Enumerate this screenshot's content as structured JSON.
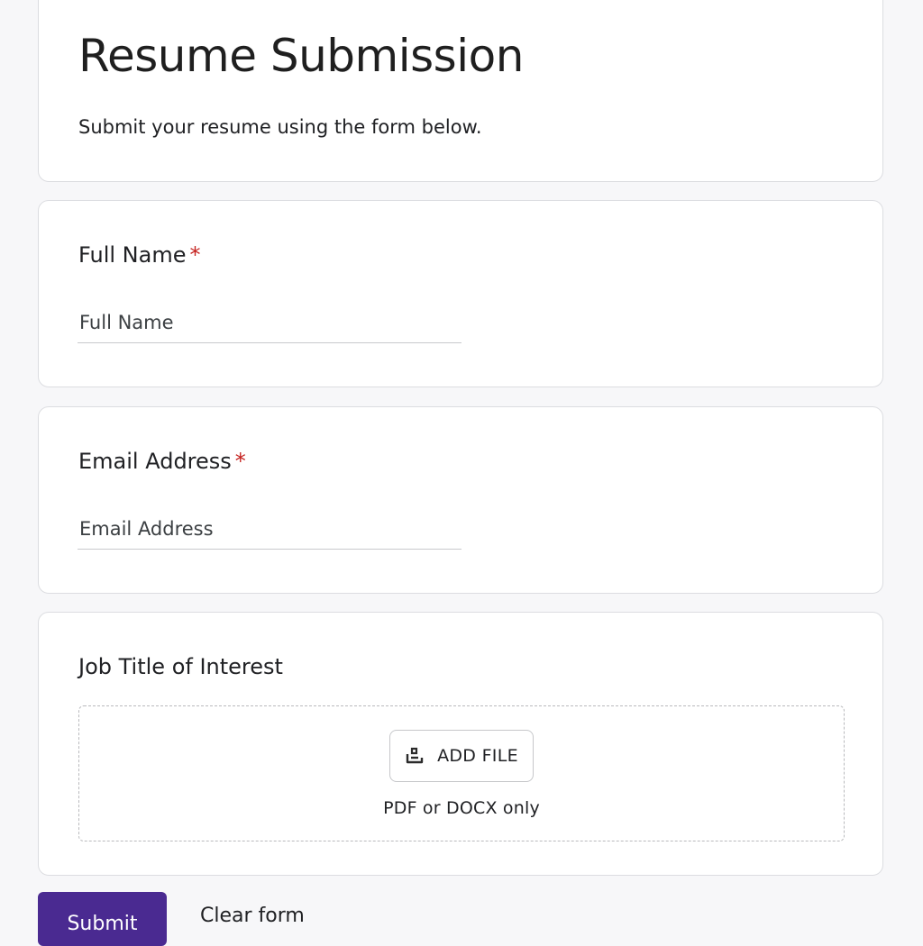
{
  "form": {
    "title": "Resume Submission",
    "description": "Submit your resume using the form below."
  },
  "questions": {
    "full_name": {
      "label": "Full Name",
      "required_mark": "*",
      "placeholder": "Full Name",
      "value": ""
    },
    "email": {
      "label": "Email Address",
      "required_mark": "*",
      "placeholder": "Email Address",
      "value": ""
    },
    "job_title": {
      "label": "Job Title of Interest",
      "add_file_label": "ADD FILE",
      "add_file_icon": "upload-file-icon",
      "file_hint": "PDF or DOCX only"
    }
  },
  "actions": {
    "submit_label": "Submit",
    "clear_label": "Clear form"
  },
  "colors": {
    "accent": "#4a2a91",
    "required": "#c5221f",
    "background": "#f7f7f9"
  }
}
